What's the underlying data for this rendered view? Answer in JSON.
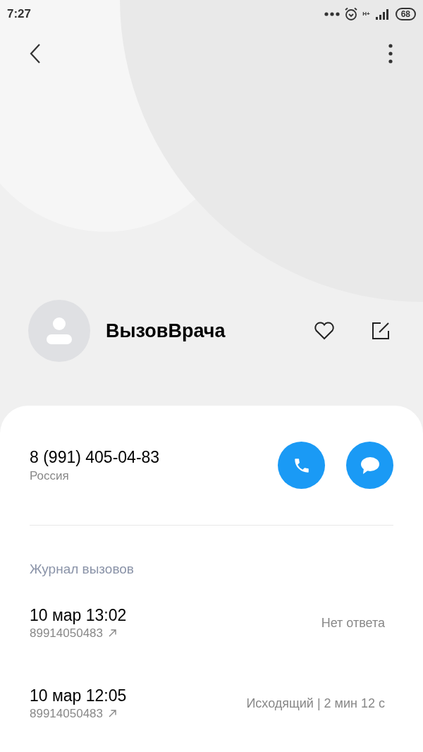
{
  "status_bar": {
    "time": "7:27",
    "network": "H+",
    "battery": "68"
  },
  "contact": {
    "name": "ВызовВрача",
    "favorite": false
  },
  "phone": {
    "number": "8 (991) 405-04-83",
    "region": "Россия"
  },
  "call_log": {
    "title": "Журнал вызовов",
    "entries": [
      {
        "datetime": "10 мар 13:02",
        "number": "89914050483",
        "status": "Нет ответа"
      },
      {
        "datetime": "10 мар 12:05",
        "number": "89914050483",
        "status": "Исходящий | 2 мин 12 с"
      }
    ]
  }
}
